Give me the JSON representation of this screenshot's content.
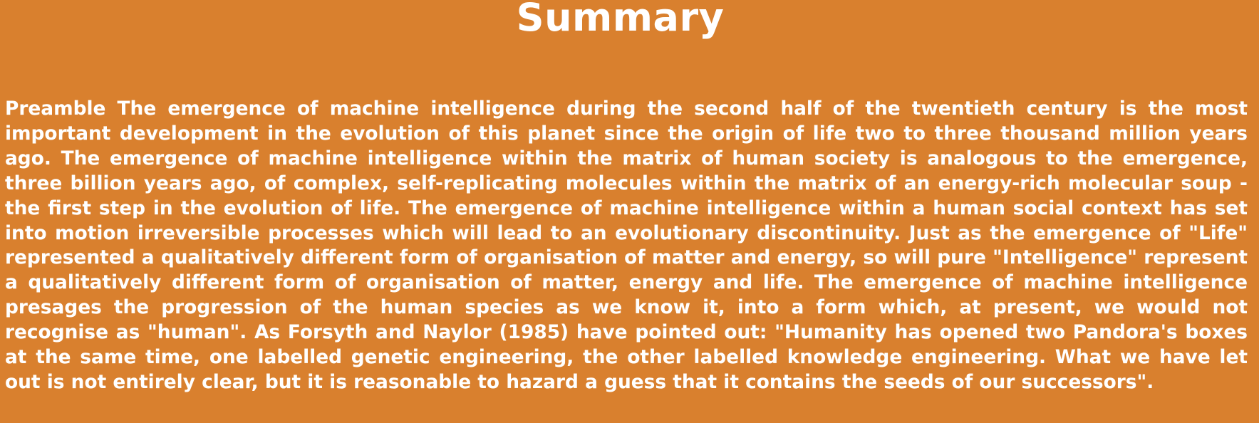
{
  "page": {
    "title": "Summary",
    "body": "Preamble The emergence of machine intelligence during the second half of the twentieth century is the most important development in the evolution of this planet since the origin of life two to three thousand million years ago. The emergence of machine intelligence within the matrix of human society is analogous to the emergence, three billion years ago, of complex, self-replicating molecules within the matrix of an energy-rich molecular soup - the first step in the evolution of life. The emergence of machine intelligence within a human social context has set into motion irreversible processes which will lead to an evolutionary discontinuity. Just as the emergence of \"Life\" represented a qualitatively different form of organisation of matter and energy, so will pure \"Intelligence\" represent a qualitatively different form of organisation of matter, energy and life. The emergence of machine intelligence presages the progression of the human species as we know it, into a form which, at present, we would not recognise as \"human\". As Forsyth and Naylor (1985) have pointed out: \"Humanity has opened two Pandora's boxes at the same time, one labelled genetic engineering, the other labelled knowledge engineering. What we have let out is not entirely clear, but it is reasonable to hazard a guess that it contains the seeds of our successors\"."
  },
  "colors": {
    "background": "#d9802e",
    "text": "#ffffff"
  }
}
